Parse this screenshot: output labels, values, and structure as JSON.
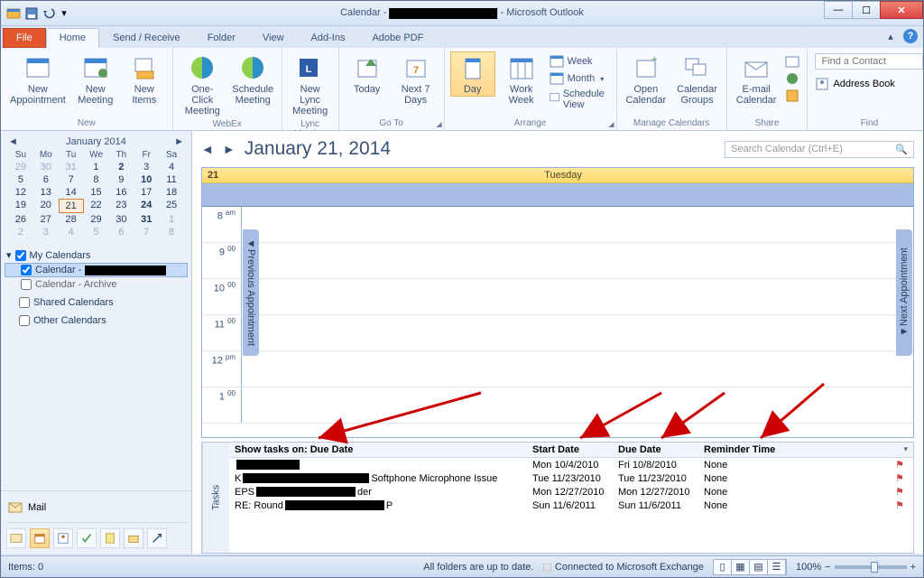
{
  "window": {
    "title_prefix": "Calendar - ",
    "title_suffix": " - Microsoft Outlook"
  },
  "tabs": {
    "file": "File",
    "home": "Home",
    "send_receive": "Send / Receive",
    "folder": "Folder",
    "view": "View",
    "addins": "Add-Ins",
    "adobe": "Adobe PDF"
  },
  "ribbon": {
    "new": {
      "appointment": "New\nAppointment",
      "meeting": "New\nMeeting",
      "items": "New\nItems",
      "group": "New"
    },
    "webex": {
      "oneclick": "One-Click\nMeeting",
      "schedule": "Schedule\nMeeting",
      "group": "WebEx"
    },
    "lync": {
      "btn": "New Lync\nMeeting",
      "group": "Lync Meeting"
    },
    "goto": {
      "today": "Today",
      "next7": "Next 7\nDays",
      "group": "Go To"
    },
    "arrange": {
      "day": "Day",
      "work": "Work\nWeek",
      "week": "Week",
      "month": "Month",
      "schedule": "Schedule View",
      "group": "Arrange"
    },
    "manage": {
      "open": "Open\nCalendar",
      "groups": "Calendar\nGroups",
      "group": "Manage Calendars"
    },
    "share": {
      "email": "E-mail\nCalendar",
      "group": "Share"
    },
    "find": {
      "contact_placeholder": "Find a Contact",
      "addressbook": "Address Book",
      "group": "Find"
    }
  },
  "minical": {
    "month": "January 2014",
    "dow": [
      "Su",
      "Mo",
      "Tu",
      "We",
      "Th",
      "Fr",
      "Sa"
    ],
    "rows": [
      [
        {
          "n": "29",
          "dim": true
        },
        {
          "n": "30",
          "dim": true
        },
        {
          "n": "31",
          "dim": true
        },
        {
          "n": "1"
        },
        {
          "n": "2",
          "bold": true
        },
        {
          "n": "3"
        },
        {
          "n": "4"
        }
      ],
      [
        {
          "n": "5"
        },
        {
          "n": "6"
        },
        {
          "n": "7"
        },
        {
          "n": "8"
        },
        {
          "n": "9"
        },
        {
          "n": "10",
          "bold": true
        },
        {
          "n": "11"
        }
      ],
      [
        {
          "n": "12"
        },
        {
          "n": "13"
        },
        {
          "n": "14"
        },
        {
          "n": "15"
        },
        {
          "n": "16"
        },
        {
          "n": "17"
        },
        {
          "n": "18"
        }
      ],
      [
        {
          "n": "19"
        },
        {
          "n": "20"
        },
        {
          "n": "21",
          "today": true
        },
        {
          "n": "22"
        },
        {
          "n": "23"
        },
        {
          "n": "24",
          "bold": true
        },
        {
          "n": "25"
        }
      ],
      [
        {
          "n": "26"
        },
        {
          "n": "27"
        },
        {
          "n": "28"
        },
        {
          "n": "29"
        },
        {
          "n": "30"
        },
        {
          "n": "31",
          "bold": true
        },
        {
          "n": "1",
          "dim": true
        }
      ],
      [
        {
          "n": "2",
          "dim": true
        },
        {
          "n": "3",
          "dim": true
        },
        {
          "n": "4",
          "dim": true
        },
        {
          "n": "5",
          "dim": true
        },
        {
          "n": "6",
          "dim": true
        },
        {
          "n": "7",
          "dim": true
        },
        {
          "n": "8",
          "dim": true
        }
      ]
    ]
  },
  "nav": {
    "mycals": "My Calendars",
    "cal1": "Calendar - ",
    "cal2": "Calendar - Archive",
    "shared": "Shared Calendars",
    "other": "Other Calendars",
    "mail": "Mail"
  },
  "calendar": {
    "date": "January 21, 2014",
    "search_placeholder": "Search Calendar (Ctrl+E)",
    "daynum": "21",
    "dayname": "Tuesday",
    "prev": "Previous Appointment",
    "next": "Next Appointment",
    "hours": [
      "8 am",
      "9 00",
      "10 00",
      "11 00",
      "12 pm",
      "1 00"
    ]
  },
  "tasks": {
    "label": "Tasks",
    "showon": "Show tasks on: Due Date",
    "col_start": "Start Date",
    "col_due": "Due Date",
    "col_reminder": "Reminder Time",
    "rows": [
      {
        "subj_pre": "",
        "subj_post": "",
        "bo": 70,
        "start": "Mon 10/4/2010",
        "due": "Fri 10/8/2010",
        "rem": "None"
      },
      {
        "subj_pre": "K",
        "subj_post": " Softphone Microphone Issue",
        "bo": 140,
        "start": "Tue 11/23/2010",
        "due": "Tue 11/23/2010",
        "rem": "None"
      },
      {
        "subj_pre": "EPS",
        "subj_post": "der",
        "bo": 110,
        "start": "Mon 12/27/2010",
        "due": "Mon 12/27/2010",
        "rem": "None"
      },
      {
        "subj_pre": "RE: Round ",
        "subj_post": "P",
        "bo": 110,
        "start": "Sun 11/6/2011",
        "due": "Sun 11/6/2011",
        "rem": "None"
      }
    ]
  },
  "status": {
    "items": "Items: 0",
    "uptodate": "All folders are up to date.",
    "connected": "Connected to Microsoft Exchange",
    "zoom": "100%"
  }
}
